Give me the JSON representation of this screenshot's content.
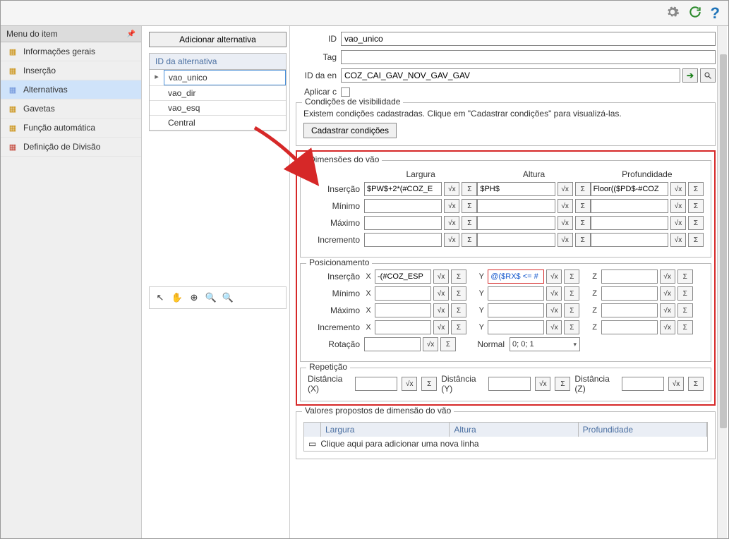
{
  "sidebar": {
    "title": "Menu do item",
    "items": [
      {
        "label": "Informações gerais"
      },
      {
        "label": "Inserção"
      },
      {
        "label": "Alternativas"
      },
      {
        "label": "Gavetas"
      },
      {
        "label": "Função automática"
      },
      {
        "label": "Definição de Divisão"
      }
    ]
  },
  "mid": {
    "add_btn": "Adicionar alternativa",
    "header": "ID da alternativa",
    "rows": [
      "vao_unico",
      "vao_dir",
      "vao_esq",
      "Central"
    ]
  },
  "form": {
    "id_label": "ID",
    "id_value": "vao_unico",
    "tag_label": "Tag",
    "tag_value": "",
    "identry_label": "ID da en",
    "identry_value": "COZ_CAI_GAV_NOV_GAV_GAV",
    "apply_label": "Aplicar c"
  },
  "cond": {
    "title": "Condições de visibilidade",
    "text": "Existem condições cadastradas. Clique em \"Cadastrar condições\" para visualizá-las.",
    "btn": "Cadastrar condições"
  },
  "dim": {
    "title": "Dimensões do vão",
    "cols": {
      "w": "Largura",
      "h": "Altura",
      "d": "Profundidade"
    },
    "rows": {
      "insercao": "Inserção",
      "minimo": "Mínimo",
      "maximo": "Máximo",
      "incremento": "Incremento"
    },
    "vals": {
      "insercao": {
        "w": "$PW$+2*(#COZ_E",
        "h": "$PH$",
        "d": "Floor(($PD$-#COZ"
      },
      "minimo": {
        "w": "",
        "h": "",
        "d": ""
      },
      "maximo": {
        "w": "",
        "h": "",
        "d": ""
      },
      "incremento": {
        "w": "",
        "h": "",
        "d": ""
      }
    }
  },
  "pos": {
    "title": "Posicionamento",
    "rows": {
      "insercao": "Inserção",
      "minimo": "Mínimo",
      "maximo": "Máximo",
      "incremento": "Incremento",
      "rotacao": "Rotação"
    },
    "vals": {
      "insercao": {
        "x": "-(#COZ_ESP",
        "y": "@($RX$ <= #",
        "z": ""
      },
      "minimo": {
        "x": "",
        "y": "",
        "z": ""
      },
      "maximo": {
        "x": "",
        "y": "",
        "z": ""
      },
      "incremento": {
        "x": "",
        "y": "",
        "z": ""
      }
    },
    "normal_lbl": "Normal",
    "normal_val": "0; 0; 1",
    "rot_val": ""
  },
  "rep": {
    "title": "Repetição",
    "dx": "Distância (X)",
    "dy": "Distância (Y)",
    "dz": "Distância (Z)"
  },
  "valprop": {
    "title": "Valores propostos de dimensão do vão",
    "cols": {
      "w": "Largura",
      "h": "Altura",
      "d": "Profundidade"
    },
    "addrow": "Clique aqui para adicionar uma nova linha"
  },
  "icons": {
    "sqrt": "√x",
    "sigma": "Σ"
  }
}
